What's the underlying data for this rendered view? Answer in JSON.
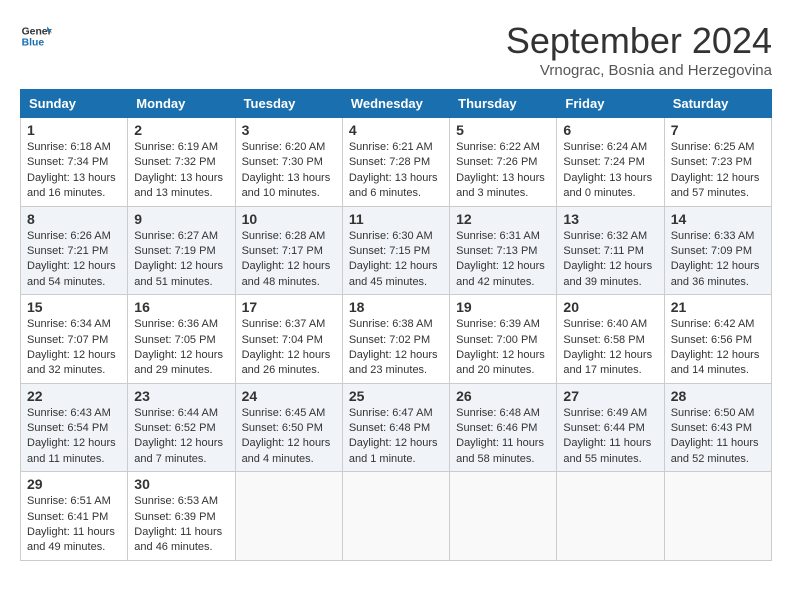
{
  "header": {
    "logo_line1": "General",
    "logo_line2": "Blue",
    "month_title": "September 2024",
    "subtitle": "Vrnograc, Bosnia and Herzegovina"
  },
  "weekdays": [
    "Sunday",
    "Monday",
    "Tuesday",
    "Wednesday",
    "Thursday",
    "Friday",
    "Saturday"
  ],
  "weeks": [
    [
      {
        "day": "1",
        "lines": [
          "Sunrise: 6:18 AM",
          "Sunset: 7:34 PM",
          "Daylight: 13 hours",
          "and 16 minutes."
        ]
      },
      {
        "day": "2",
        "lines": [
          "Sunrise: 6:19 AM",
          "Sunset: 7:32 PM",
          "Daylight: 13 hours",
          "and 13 minutes."
        ]
      },
      {
        "day": "3",
        "lines": [
          "Sunrise: 6:20 AM",
          "Sunset: 7:30 PM",
          "Daylight: 13 hours",
          "and 10 minutes."
        ]
      },
      {
        "day": "4",
        "lines": [
          "Sunrise: 6:21 AM",
          "Sunset: 7:28 PM",
          "Daylight: 13 hours",
          "and 6 minutes."
        ]
      },
      {
        "day": "5",
        "lines": [
          "Sunrise: 6:22 AM",
          "Sunset: 7:26 PM",
          "Daylight: 13 hours",
          "and 3 minutes."
        ]
      },
      {
        "day": "6",
        "lines": [
          "Sunrise: 6:24 AM",
          "Sunset: 7:24 PM",
          "Daylight: 13 hours",
          "and 0 minutes."
        ]
      },
      {
        "day": "7",
        "lines": [
          "Sunrise: 6:25 AM",
          "Sunset: 7:23 PM",
          "Daylight: 12 hours",
          "and 57 minutes."
        ]
      }
    ],
    [
      {
        "day": "8",
        "lines": [
          "Sunrise: 6:26 AM",
          "Sunset: 7:21 PM",
          "Daylight: 12 hours",
          "and 54 minutes."
        ]
      },
      {
        "day": "9",
        "lines": [
          "Sunrise: 6:27 AM",
          "Sunset: 7:19 PM",
          "Daylight: 12 hours",
          "and 51 minutes."
        ]
      },
      {
        "day": "10",
        "lines": [
          "Sunrise: 6:28 AM",
          "Sunset: 7:17 PM",
          "Daylight: 12 hours",
          "and 48 minutes."
        ]
      },
      {
        "day": "11",
        "lines": [
          "Sunrise: 6:30 AM",
          "Sunset: 7:15 PM",
          "Daylight: 12 hours",
          "and 45 minutes."
        ]
      },
      {
        "day": "12",
        "lines": [
          "Sunrise: 6:31 AM",
          "Sunset: 7:13 PM",
          "Daylight: 12 hours",
          "and 42 minutes."
        ]
      },
      {
        "day": "13",
        "lines": [
          "Sunrise: 6:32 AM",
          "Sunset: 7:11 PM",
          "Daylight: 12 hours",
          "and 39 minutes."
        ]
      },
      {
        "day": "14",
        "lines": [
          "Sunrise: 6:33 AM",
          "Sunset: 7:09 PM",
          "Daylight: 12 hours",
          "and 36 minutes."
        ]
      }
    ],
    [
      {
        "day": "15",
        "lines": [
          "Sunrise: 6:34 AM",
          "Sunset: 7:07 PM",
          "Daylight: 12 hours",
          "and 32 minutes."
        ]
      },
      {
        "day": "16",
        "lines": [
          "Sunrise: 6:36 AM",
          "Sunset: 7:05 PM",
          "Daylight: 12 hours",
          "and 29 minutes."
        ]
      },
      {
        "day": "17",
        "lines": [
          "Sunrise: 6:37 AM",
          "Sunset: 7:04 PM",
          "Daylight: 12 hours",
          "and 26 minutes."
        ]
      },
      {
        "day": "18",
        "lines": [
          "Sunrise: 6:38 AM",
          "Sunset: 7:02 PM",
          "Daylight: 12 hours",
          "and 23 minutes."
        ]
      },
      {
        "day": "19",
        "lines": [
          "Sunrise: 6:39 AM",
          "Sunset: 7:00 PM",
          "Daylight: 12 hours",
          "and 20 minutes."
        ]
      },
      {
        "day": "20",
        "lines": [
          "Sunrise: 6:40 AM",
          "Sunset: 6:58 PM",
          "Daylight: 12 hours",
          "and 17 minutes."
        ]
      },
      {
        "day": "21",
        "lines": [
          "Sunrise: 6:42 AM",
          "Sunset: 6:56 PM",
          "Daylight: 12 hours",
          "and 14 minutes."
        ]
      }
    ],
    [
      {
        "day": "22",
        "lines": [
          "Sunrise: 6:43 AM",
          "Sunset: 6:54 PM",
          "Daylight: 12 hours",
          "and 11 minutes."
        ]
      },
      {
        "day": "23",
        "lines": [
          "Sunrise: 6:44 AM",
          "Sunset: 6:52 PM",
          "Daylight: 12 hours",
          "and 7 minutes."
        ]
      },
      {
        "day": "24",
        "lines": [
          "Sunrise: 6:45 AM",
          "Sunset: 6:50 PM",
          "Daylight: 12 hours",
          "and 4 minutes."
        ]
      },
      {
        "day": "25",
        "lines": [
          "Sunrise: 6:47 AM",
          "Sunset: 6:48 PM",
          "Daylight: 12 hours",
          "and 1 minute."
        ]
      },
      {
        "day": "26",
        "lines": [
          "Sunrise: 6:48 AM",
          "Sunset: 6:46 PM",
          "Daylight: 11 hours",
          "and 58 minutes."
        ]
      },
      {
        "day": "27",
        "lines": [
          "Sunrise: 6:49 AM",
          "Sunset: 6:44 PM",
          "Daylight: 11 hours",
          "and 55 minutes."
        ]
      },
      {
        "day": "28",
        "lines": [
          "Sunrise: 6:50 AM",
          "Sunset: 6:43 PM",
          "Daylight: 11 hours",
          "and 52 minutes."
        ]
      }
    ],
    [
      {
        "day": "29",
        "lines": [
          "Sunrise: 6:51 AM",
          "Sunset: 6:41 PM",
          "Daylight: 11 hours",
          "and 49 minutes."
        ]
      },
      {
        "day": "30",
        "lines": [
          "Sunrise: 6:53 AM",
          "Sunset: 6:39 PM",
          "Daylight: 11 hours",
          "and 46 minutes."
        ]
      },
      {
        "day": "",
        "lines": []
      },
      {
        "day": "",
        "lines": []
      },
      {
        "day": "",
        "lines": []
      },
      {
        "day": "",
        "lines": []
      },
      {
        "day": "",
        "lines": []
      }
    ]
  ]
}
